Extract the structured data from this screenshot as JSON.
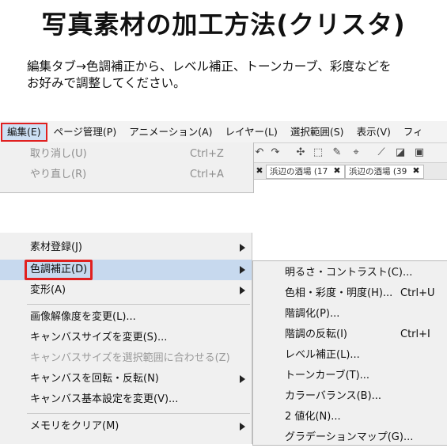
{
  "title": "写真素材の加工方法(クリスタ)",
  "description": [
    "編集タブ→色調補正から、レベル補正、トーンカーブ、彩度などを",
    "お好みで調整してください。"
  ],
  "menubar": {
    "items": [
      "編集(E)",
      "ページ管理(P)",
      "アニメーション(A)",
      "レイヤー(L)",
      "選択範囲(S)",
      "表示(V)",
      "フィ"
    ]
  },
  "toolbar": {
    "icons": [
      "undo-icon",
      "redo-icon",
      "sparkle-icon",
      "transform-icon",
      "brush-icon",
      "fit-icon",
      "ruler-icon",
      "gradient-icon",
      "frame-icon"
    ]
  },
  "tabs": [
    "浜辺の酒場 (17",
    "浜辺の酒場 (39"
  ],
  "edit_menu": {
    "undo": {
      "label": "取り消し(U)",
      "shortcut": "Ctrl+Z"
    },
    "redo": {
      "label": "やり直し(R)",
      "shortcut": "Ctrl+A"
    }
  },
  "main_menu": {
    "items": [
      "素材登録(J)",
      "色調補正(D)",
      "変形(A)",
      "画像解像度を変更(L)...",
      "キャンバスサイズを変更(S)...",
      "キャンバスサイズを選択範囲に合わせる(Z)",
      "キャンバスを回転・反転(N)",
      "キャンバス基本設定を変更(V)...",
      "メモリをクリア(M)"
    ]
  },
  "submenu": {
    "items": [
      {
        "label": "明るさ・コントラスト(C)...",
        "shortcut": ""
      },
      {
        "label": "色相・彩度・明度(H)...",
        "shortcut": "Ctrl+U"
      },
      {
        "label": "階調化(P)...",
        "shortcut": ""
      },
      {
        "label": "階調の反転(I)",
        "shortcut": "Ctrl+I"
      },
      {
        "label": "レベル補正(L)...",
        "shortcut": ""
      },
      {
        "label": "トーンカーブ(T)...",
        "shortcut": ""
      },
      {
        "label": "カラーバランス(B)...",
        "shortcut": ""
      },
      {
        "label": "2 値化(N)...",
        "shortcut": ""
      },
      {
        "label": "グラデーションマップ(G)...",
        "shortcut": ""
      }
    ]
  },
  "colors": {
    "highlight_border": "#e02020",
    "highlight_bg": "#c7d9ee",
    "menu_bg": "#f0f0f0"
  }
}
